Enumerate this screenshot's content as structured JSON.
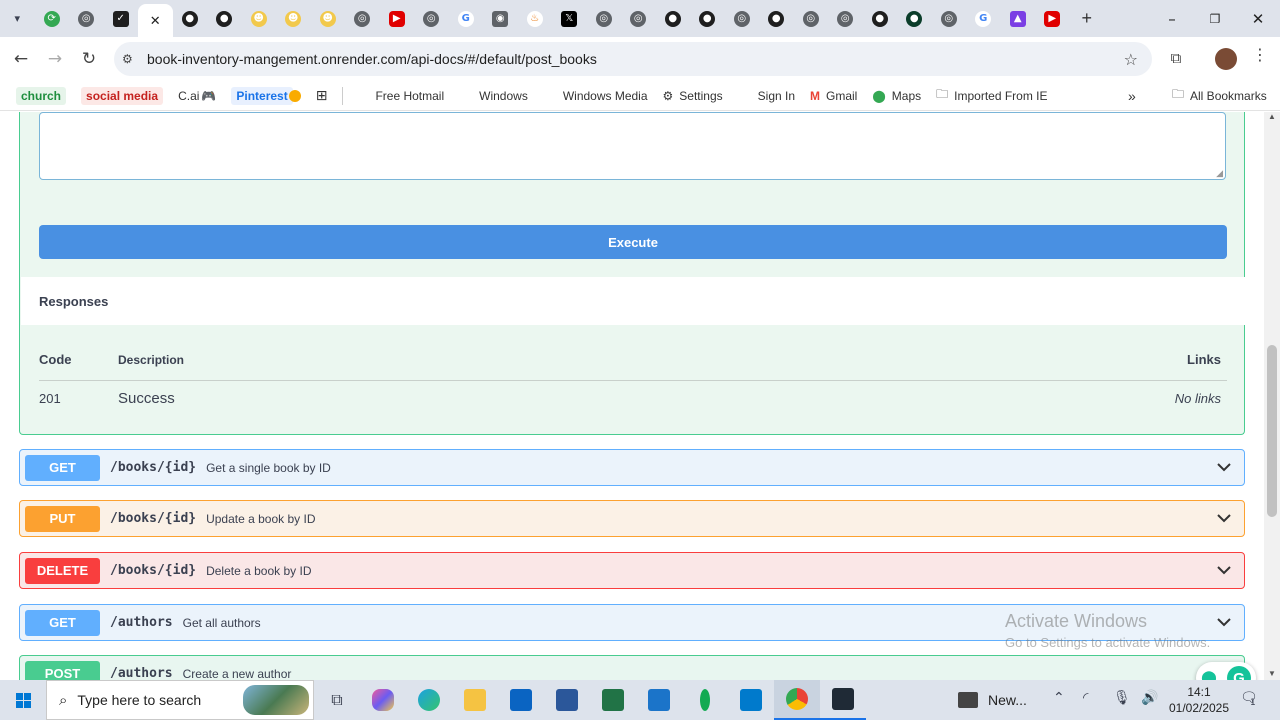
{
  "browser": {
    "tabs": [
      {
        "icon": "tab-list-icon"
      },
      {
        "icon": "green-circle-icon"
      },
      {
        "icon": "globe-icon"
      },
      {
        "icon": "render-icon"
      },
      {
        "icon": "active-tab-close-icon",
        "close": "✕"
      },
      {
        "icon": "github-icon"
      },
      {
        "icon": "github-icon"
      },
      {
        "icon": "yellow-icon"
      },
      {
        "icon": "yellow-icon"
      },
      {
        "icon": "yellow-icon"
      },
      {
        "icon": "globe-icon"
      },
      {
        "icon": "youtube-icon"
      },
      {
        "icon": "globe-icon"
      },
      {
        "icon": "google-icon"
      },
      {
        "icon": "camera-icon"
      },
      {
        "icon": "java-icon"
      },
      {
        "icon": "x-icon"
      },
      {
        "icon": "globe-icon"
      },
      {
        "icon": "globe-icon"
      },
      {
        "icon": "github-icon"
      },
      {
        "icon": "github-icon"
      },
      {
        "icon": "globe-icon"
      },
      {
        "icon": "github-icon"
      },
      {
        "icon": "globe-icon"
      },
      {
        "icon": "globe-icon"
      },
      {
        "icon": "github-icon"
      },
      {
        "icon": "green-dot-icon"
      },
      {
        "icon": "globe-icon"
      },
      {
        "icon": "google-icon"
      },
      {
        "icon": "purple-icon"
      },
      {
        "icon": "youtube-icon"
      }
    ],
    "new_tab": "+",
    "url": "book-inventory-mangement.onrender.com/api-docs/#/default/post_books",
    "bookmarks": [
      {
        "label": "church",
        "type": "chip",
        "color": "#1e8e3e",
        "bg": "#e6f4ea"
      },
      {
        "label": "social media",
        "type": "chip",
        "color": "#c5221f",
        "bg": "#fce8e6"
      },
      {
        "label": "C.ai",
        "type": "text"
      },
      {
        "label": "Pinterest",
        "type": "chip",
        "color": "#1a73e8",
        "bg": "#e8f0fe"
      },
      {
        "label": "",
        "type": "apps"
      },
      {
        "label": "Free Hotmail",
        "type": "ms"
      },
      {
        "label": "Windows",
        "type": "ms"
      },
      {
        "label": "Windows Media",
        "type": "ms"
      },
      {
        "label": "Settings",
        "type": "gear"
      },
      {
        "label": "Sign In",
        "type": "ms"
      },
      {
        "label": "Gmail",
        "type": "gmail"
      },
      {
        "label": "Maps",
        "type": "maps"
      },
      {
        "label": "Imported From IE",
        "type": "folder"
      }
    ],
    "all_bookmarks": "All Bookmarks"
  },
  "post_section": {
    "execute_label": "Execute",
    "responses_title": "Responses",
    "table": {
      "headers": {
        "code": "Code",
        "description": "Description",
        "links": "Links"
      },
      "rows": [
        {
          "code": "201",
          "description": "Success",
          "links": "No links"
        }
      ]
    }
  },
  "operations": [
    {
      "method": "GET",
      "path": "/books/{id}",
      "summary": "Get a single book by ID",
      "color": "#61affe",
      "bg": "#ebf3fb"
    },
    {
      "method": "PUT",
      "path": "/books/{id}",
      "summary": "Update a book by ID",
      "color": "#fca130",
      "bg": "#fbf1e6"
    },
    {
      "method": "DELETE",
      "path": "/books/{id}",
      "summary": "Delete a book by ID",
      "color": "#f93e3e",
      "bg": "#fae7e7"
    },
    {
      "method": "GET",
      "path": "/authors",
      "summary": "Get all authors",
      "color": "#61affe",
      "bg": "#ebf3fb"
    },
    {
      "method": "POST",
      "path": "/authors",
      "summary": "Create a new author",
      "color": "#49cc90",
      "bg": "#e8f6f0"
    }
  ],
  "watermark": {
    "line1": "Activate Windows",
    "line2": "Go to Settings to activate Windows."
  },
  "taskbar": {
    "search_placeholder": "Type here to search",
    "news_label": "New...",
    "time": "14:1",
    "date": "01/02/2025",
    "notification_count": "1"
  }
}
